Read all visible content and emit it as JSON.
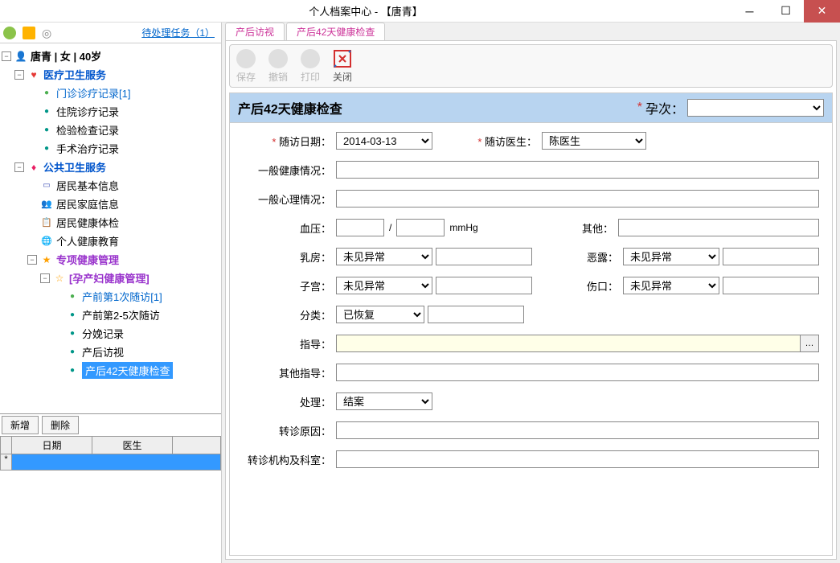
{
  "window": {
    "title": "个人档案中心 - 【唐青】"
  },
  "leftToolbar": {
    "pendingTasks": "待处理任务（1）"
  },
  "tree": {
    "patient": "唐青  |  女  |  40岁",
    "medical": "医疗卫生服务",
    "medicalItems": {
      "outpatient": "门诊诊疗记录[1]",
      "inpatient": "住院诊疗记录",
      "lab": "检验检查记录",
      "surgery": "手术治疗记录"
    },
    "publicHealth": "公共卫生服务",
    "publicItems": {
      "basicInfo": "居民基本信息",
      "familyInfo": "居民家庭信息",
      "healthExam": "居民健康体检",
      "healthEdu": "个人健康教育",
      "special": "专项健康管理",
      "maternal": "[孕产妇健康管理]",
      "prenatal1": "产前第1次随访[1]",
      "prenatal25": "产前第2-5次随访",
      "delivery": "分娩记录",
      "postVisit": "产后访视",
      "post42": "产后42天健康检查"
    }
  },
  "buttons": {
    "add": "新增",
    "delete": "删除"
  },
  "gridCols": {
    "date": "日期",
    "doctor": "医生"
  },
  "tabs": {
    "tab1": "产后访视",
    "tab2": "产后42天健康检查"
  },
  "toolbar": {
    "save": "保存",
    "undo": "撤销",
    "print": "打印",
    "close": "关闭"
  },
  "form": {
    "title": "产后42天健康检查",
    "pregnancyLabel": "孕次：",
    "visitDateLabel": "随访日期：",
    "visitDateValue": "2014-03-13",
    "visitDoctorLabel": "随访医生：",
    "visitDoctorValue": "陈医生",
    "generalHealthLabel": "一般健康情况：",
    "generalPsychLabel": "一般心理情况：",
    "bpLabel": "血压：",
    "bpSep": "/",
    "bpUnit": "mmHg",
    "otherLabel": "其他：",
    "breastLabel": "乳房：",
    "breastValue": "未见异常",
    "lochiaLabel": "恶露：",
    "lochiaValue": "未见异常",
    "uterusLabel": "子宫：",
    "uterusValue": "未见异常",
    "woundLabel": "伤口：",
    "woundValue": "未见异常",
    "classifyLabel": "分类：",
    "classifyValue": "已恢复",
    "guidanceLabel": "指导：",
    "otherGuidanceLabel": "其他指导：",
    "handleLabel": "处理：",
    "handleValue": "结案",
    "referReasonLabel": "转诊原因：",
    "referOrgLabel": "转诊机构及科室："
  }
}
